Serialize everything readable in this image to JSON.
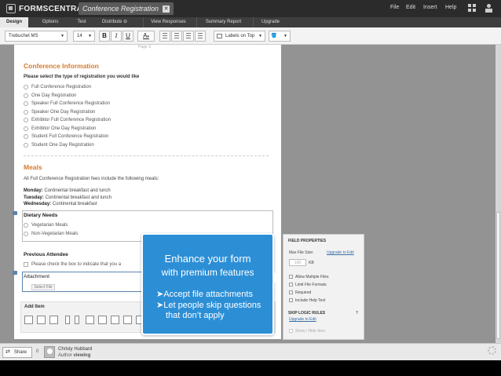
{
  "app": {
    "logo": "FORMSCENTRAL",
    "document_title": "Conference Registration",
    "menu": [
      "File",
      "Edit",
      "Insert",
      "Help"
    ]
  },
  "tabs": [
    "Design",
    "Options",
    "Test",
    "Distribute",
    "View Responses",
    "Summary Report",
    "Upgrade"
  ],
  "toolbar": {
    "font": "Trebuchet MS",
    "size": "14",
    "bold": "B",
    "italic": "I",
    "underline": "U",
    "text_color": "A",
    "labels_position": "Labels on Top"
  },
  "form": {
    "page_label": "Page 3",
    "conference_heading": "Conference Information",
    "registration_question": "Please select the type of registration you would like",
    "registration_options": [
      "Full Conference Registration",
      "One Day Registration",
      "Speaker Full Conference Registration",
      "Speaker One Day Registration",
      "Exhibitor Full Conference Registration",
      "Exhibitor One Day Registration",
      "Student Full Conference Registration",
      "Student One Day Registration"
    ],
    "meals_heading": "Meals",
    "meals_intro": "All Full Conference Registration fees include the following meals:",
    "meals": [
      {
        "day": "Monday:",
        "meal": " Continental breakfast and lunch"
      },
      {
        "day": "Tuesday:",
        "meal": " Continental breakfast and lunch"
      },
      {
        "day": "Wednesday:",
        "meal": " Continental breakfast"
      }
    ],
    "dietary_label": "Dietary Needs",
    "dietary_options": [
      "Vegetarian Meals",
      "Non-Vegetarian Meals"
    ],
    "previous_attendee_label": "Previous Attendee",
    "previous_attendee_text": "Please check the box to indicate that you a",
    "attachment_label": "Attachment",
    "select_file": "Select File",
    "add_item": "Add Item"
  },
  "properties": {
    "heading": "FIELD PROPERTIES",
    "max_file_size": "Max File Size:",
    "upgrade_to_edit": "Upgrade to Edit",
    "kb_value": "100",
    "kb": "KB",
    "checkbox_options": [
      "Allow Multiple Files",
      "Limit File Formats",
      "Required",
      "Include Help Text"
    ],
    "skip_logic_heading": "SKIP LOGIC RULES",
    "skip_logic_help": "?",
    "skip_logic_upgrade": "Upgrade to Edit",
    "show_hide_item": "Show / Hide Item"
  },
  "promo": {
    "line1": "Enhance your form",
    "line2": "with premium features",
    "bullets": [
      "Accept file attachments",
      "Let people skip questions",
      "that don’t apply"
    ]
  },
  "footer": {
    "share": "Share",
    "user_count": "0",
    "user_name": "Christy Hubbard",
    "user_role": "Author",
    "user_status": "viewing"
  }
}
